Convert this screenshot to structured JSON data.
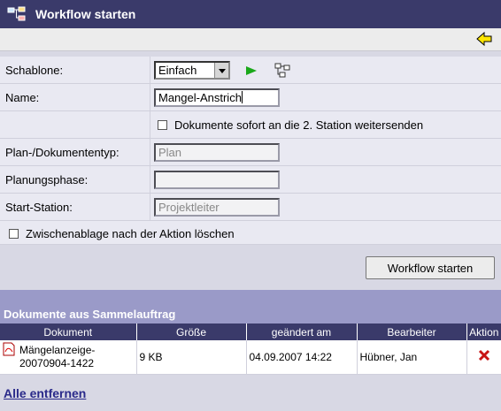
{
  "window": {
    "title": "Workflow starten"
  },
  "form": {
    "schablone": {
      "label": "Schablone:",
      "value": "Einfach"
    },
    "name": {
      "label": "Name:",
      "value": "Mangel-Anstrich"
    },
    "send_option": {
      "label": "Dokumente sofort an die 2. Station weitersenden",
      "checked": false
    },
    "plan_type": {
      "label": "Plan-/Dokumententyp:",
      "value": "Plan"
    },
    "phase": {
      "label": "Planungsphase:",
      "value": ""
    },
    "start_station": {
      "label": "Start-Station:",
      "value": "Projektleiter"
    },
    "clear_clipboard": {
      "label": "Zwischenablage nach der Aktion löschen",
      "checked": false
    }
  },
  "actions": {
    "start_label": "Workflow starten"
  },
  "documents": {
    "title": "Dokumente aus Sammelauftrag",
    "columns": [
      "Dokument",
      "Größe",
      "geändert am",
      "Bearbeiter",
      "Aktion"
    ],
    "rows": [
      {
        "name": "Mängelanzeige-20070904-1422",
        "size": "9 KB",
        "changed": "04.09.2007 14:22",
        "editor": "Hübner, Jan"
      }
    ],
    "remove_all_label": "Alle entfernen"
  },
  "icons": {
    "workflow": "workflow-icon",
    "back": "back-arrow-icon",
    "go": "play-icon",
    "tree": "workflow-tree-icon",
    "pdf": "pdf-icon",
    "delete": "delete-x-icon"
  },
  "colors": {
    "titlebar": "#3a3a6a",
    "section_header": "#9a9ac8",
    "go_green": "#1aa81a",
    "delete_red": "#c81414",
    "link": "#2a2a8a"
  }
}
